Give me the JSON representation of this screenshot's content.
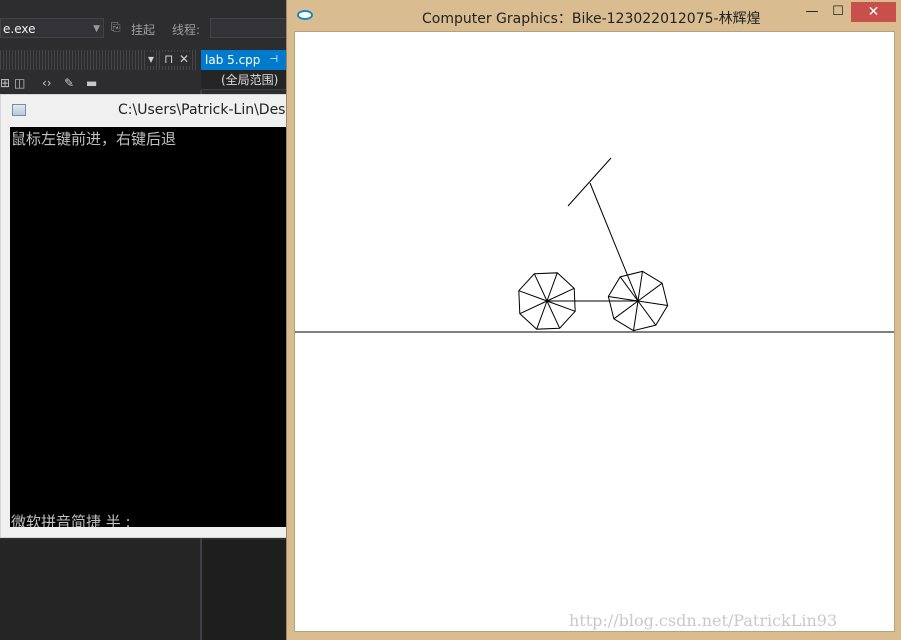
{
  "vs": {
    "toolbar": {
      "exe_dropdown": "e.exe",
      "attach_label": "挂起",
      "thread_label": "线程:"
    },
    "panel_buttons": [
      "▾",
      "⊓",
      "✕"
    ],
    "icon_names": [
      "tool-icon-a",
      "tool-icon-b",
      "code-icon",
      "wrench-icon",
      "minus-icon"
    ],
    "tab": {
      "label": "lab 5.cpp",
      "pin": "⊣"
    },
    "scope": "(全局范围)"
  },
  "console": {
    "title": "C:\\Users\\Patrick-Lin\\Des",
    "line1": "鼠标左键前进，右键后退",
    "ime_status": "微软拼音简捷 半 :"
  },
  "gfx": {
    "title": "Computer Graphics：Bike-123022012075-林辉煌",
    "controls": {
      "minimize": "—",
      "maximize": "☐",
      "close": "✕"
    },
    "watermark": "http://blog.csdn.net/PatrickLin93"
  }
}
